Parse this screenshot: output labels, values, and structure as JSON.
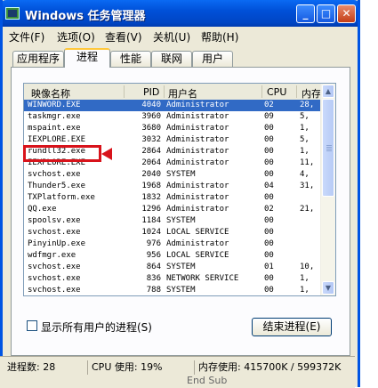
{
  "window": {
    "title": "Windows 任务管理器",
    "buttons": {
      "minimize": "_",
      "maximize": "□",
      "close": "✕"
    }
  },
  "menu": [
    {
      "label": "文件(F)"
    },
    {
      "label": "选项(O)"
    },
    {
      "label": "查看(V)"
    },
    {
      "label": "关机(U)"
    },
    {
      "label": "帮助(H)"
    }
  ],
  "tabs": [
    {
      "label": "应用程序"
    },
    {
      "label": "进程"
    },
    {
      "label": "性能"
    },
    {
      "label": "联网"
    },
    {
      "label": "用户"
    }
  ],
  "columns": {
    "name": "映像名称",
    "pid": "PID",
    "user": "用户名",
    "cpu": "CPU",
    "mem": "内存"
  },
  "processes": [
    {
      "name": "WINWORD.EXE",
      "pid": "4040",
      "user": "Administrator",
      "cpu": "02",
      "mem": "28,"
    },
    {
      "name": "taskmgr.exe",
      "pid": "3960",
      "user": "Administrator",
      "cpu": "09",
      "mem": "5,"
    },
    {
      "name": "mspaint.exe",
      "pid": "3680",
      "user": "Administrator",
      "cpu": "00",
      "mem": "1,"
    },
    {
      "name": "IEXPLORE.EXE",
      "pid": "3032",
      "user": "Administrator",
      "cpu": "00",
      "mem": "5,"
    },
    {
      "name": "rundll32.exe",
      "pid": "2864",
      "user": "Administrator",
      "cpu": "00",
      "mem": "1,"
    },
    {
      "name": "IEXPLORE.EXE",
      "pid": "2064",
      "user": "Administrator",
      "cpu": "00",
      "mem": "11,"
    },
    {
      "name": "svchost.exe",
      "pid": "2040",
      "user": "SYSTEM",
      "cpu": "00",
      "mem": "4,"
    },
    {
      "name": "Thunder5.exe",
      "pid": "1968",
      "user": "Administrator",
      "cpu": "04",
      "mem": "31,"
    },
    {
      "name": "TXPlatform.exe",
      "pid": "1832",
      "user": "Administrator",
      "cpu": "00",
      "mem": ""
    },
    {
      "name": "QQ.exe",
      "pid": "1296",
      "user": "Administrator",
      "cpu": "02",
      "mem": "21,"
    },
    {
      "name": "spoolsv.exe",
      "pid": "1184",
      "user": "SYSTEM",
      "cpu": "00",
      "mem": ""
    },
    {
      "name": "svchost.exe",
      "pid": "1024",
      "user": "LOCAL SERVICE",
      "cpu": "00",
      "mem": ""
    },
    {
      "name": "PinyinUp.exe",
      "pid": "976",
      "user": "Administrator",
      "cpu": "00",
      "mem": ""
    },
    {
      "name": "wdfmgr.exe",
      "pid": "956",
      "user": "LOCAL SERVICE",
      "cpu": "00",
      "mem": ""
    },
    {
      "name": "svchost.exe",
      "pid": "864",
      "user": "SYSTEM",
      "cpu": "01",
      "mem": "10,"
    },
    {
      "name": "svchost.exe",
      "pid": "836",
      "user": "NETWORK SERVICE",
      "cpu": "00",
      "mem": "1,"
    },
    {
      "name": "svchost.exe",
      "pid": "788",
      "user": "SYSTEM",
      "cpu": "00",
      "mem": "1,"
    }
  ],
  "selected_row": 0,
  "highlighted_row": 4,
  "show_all_label": "显示所有用户的进程(S)",
  "end_process_label": "结束进程(E)",
  "status": {
    "processes": "进程数: 28",
    "cpu": "CPU 使用: 19%",
    "memory": "内存使用: 415700K / 599372K"
  },
  "background_text": "End Sub"
}
